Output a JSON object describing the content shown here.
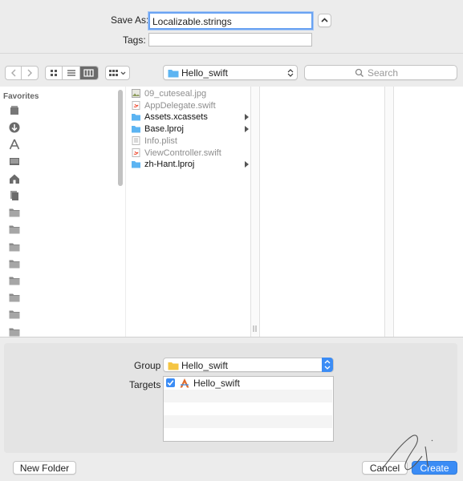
{
  "save_as": {
    "label": "Save As:",
    "value": "Localizable.strings"
  },
  "tags": {
    "label": "Tags:",
    "value": ""
  },
  "toolbar": {
    "location": "Hello_swift",
    "search_placeholder": "Search"
  },
  "sidebar": {
    "heading": "Favorites",
    "icons": [
      "all-my-files-icon",
      "downloads-icon",
      "applications-icon",
      "desktop-icon",
      "home-icon",
      "documents-icon",
      "folder-icon",
      "folder-icon",
      "folder-icon",
      "folder-icon",
      "folder-icon",
      "folder-icon",
      "folder-icon",
      "folder-icon"
    ]
  },
  "files": [
    {
      "name": "09_cuteseal.jpg",
      "kind": "image",
      "dimmed": true,
      "folder": false
    },
    {
      "name": "AppDelegate.swift",
      "kind": "swift",
      "dimmed": true,
      "folder": false
    },
    {
      "name": "Assets.xcassets",
      "kind": "folder",
      "dimmed": false,
      "folder": true
    },
    {
      "name": "Base.lproj",
      "kind": "folder",
      "dimmed": false,
      "folder": true
    },
    {
      "name": "Info.plist",
      "kind": "plist",
      "dimmed": true,
      "folder": false
    },
    {
      "name": "ViewController.swift",
      "kind": "swift",
      "dimmed": true,
      "folder": false
    },
    {
      "name": "zh-Hant.lproj",
      "kind": "folder",
      "dimmed": false,
      "folder": true
    }
  ],
  "group": {
    "label": "Group",
    "value": "Hello_swift"
  },
  "targets": {
    "label": "Targets",
    "items": [
      {
        "name": "Hello_swift",
        "checked": true
      }
    ]
  },
  "buttons": {
    "new_folder": "New Folder",
    "cancel": "Cancel",
    "create": "Create"
  },
  "colors": {
    "accent": "#3b8cf5",
    "folder": "#5cb4f2",
    "group_folder": "#f5c542"
  }
}
